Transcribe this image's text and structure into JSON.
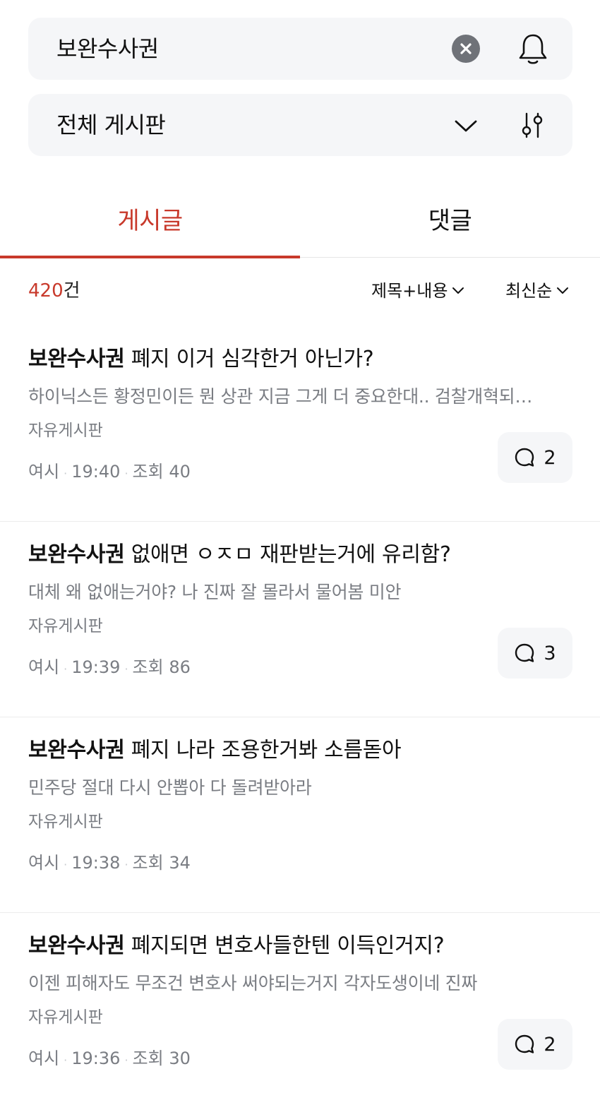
{
  "search": {
    "query": "보완수사권",
    "clear_icon": "close-circle-icon",
    "notification_icon": "bell-icon"
  },
  "board_filter": {
    "selected": "전체 게시판",
    "dropdown_icon": "chevron-down-icon",
    "filter_icon": "sliders-icon"
  },
  "tabs": [
    {
      "label": "게시글",
      "active": true
    },
    {
      "label": "댓글",
      "active": false
    }
  ],
  "results": {
    "count": "420",
    "unit": "건",
    "search_scope": "제목+내용",
    "sort_order": "최신순"
  },
  "colors": {
    "accent": "#c8392b",
    "muted_text": "#7a7d83",
    "panel_bg": "#f5f6f8"
  },
  "posts": [
    {
      "keyword": "보완수사권",
      "title_rest": " 폐지 이거 심각한거 아닌가?",
      "preview": "하이닉스든 황정민이든 뭔 상관 지금 그게 더 중요한대.. 검찰개혁되…",
      "board": "자유게시판",
      "author": "여시",
      "time": "19:40",
      "views_label": "조회",
      "views": "40",
      "comments": "2"
    },
    {
      "keyword": "보완수사권",
      "title_rest": " 없애면 ㅇㅈㅁ 재판받는거에 유리함?",
      "preview": "대체 왜 없애는거야? 나 진짜 잘 몰라서 물어봄 미안",
      "board": "자유게시판",
      "author": "여시",
      "time": "19:39",
      "views_label": "조회",
      "views": "86",
      "comments": "3"
    },
    {
      "keyword": "보완수사권",
      "title_rest": " 폐지 나라 조용한거봐 소름돋아",
      "preview": "민주당 절대 다시 안뽑아 다 돌려받아라",
      "board": "자유게시판",
      "author": "여시",
      "time": "19:38",
      "views_label": "조회",
      "views": "34",
      "comments": null
    },
    {
      "keyword": "보완수사권",
      "title_rest": " 폐지되면 변호사들한텐 이득인거지?",
      "preview": "이젠 피해자도 무조건 변호사 써야되는거지 각자도생이네 진짜",
      "board": "자유게시판",
      "author": "여시",
      "time": "19:36",
      "views_label": "조회",
      "views": "30",
      "comments": "2"
    }
  ]
}
